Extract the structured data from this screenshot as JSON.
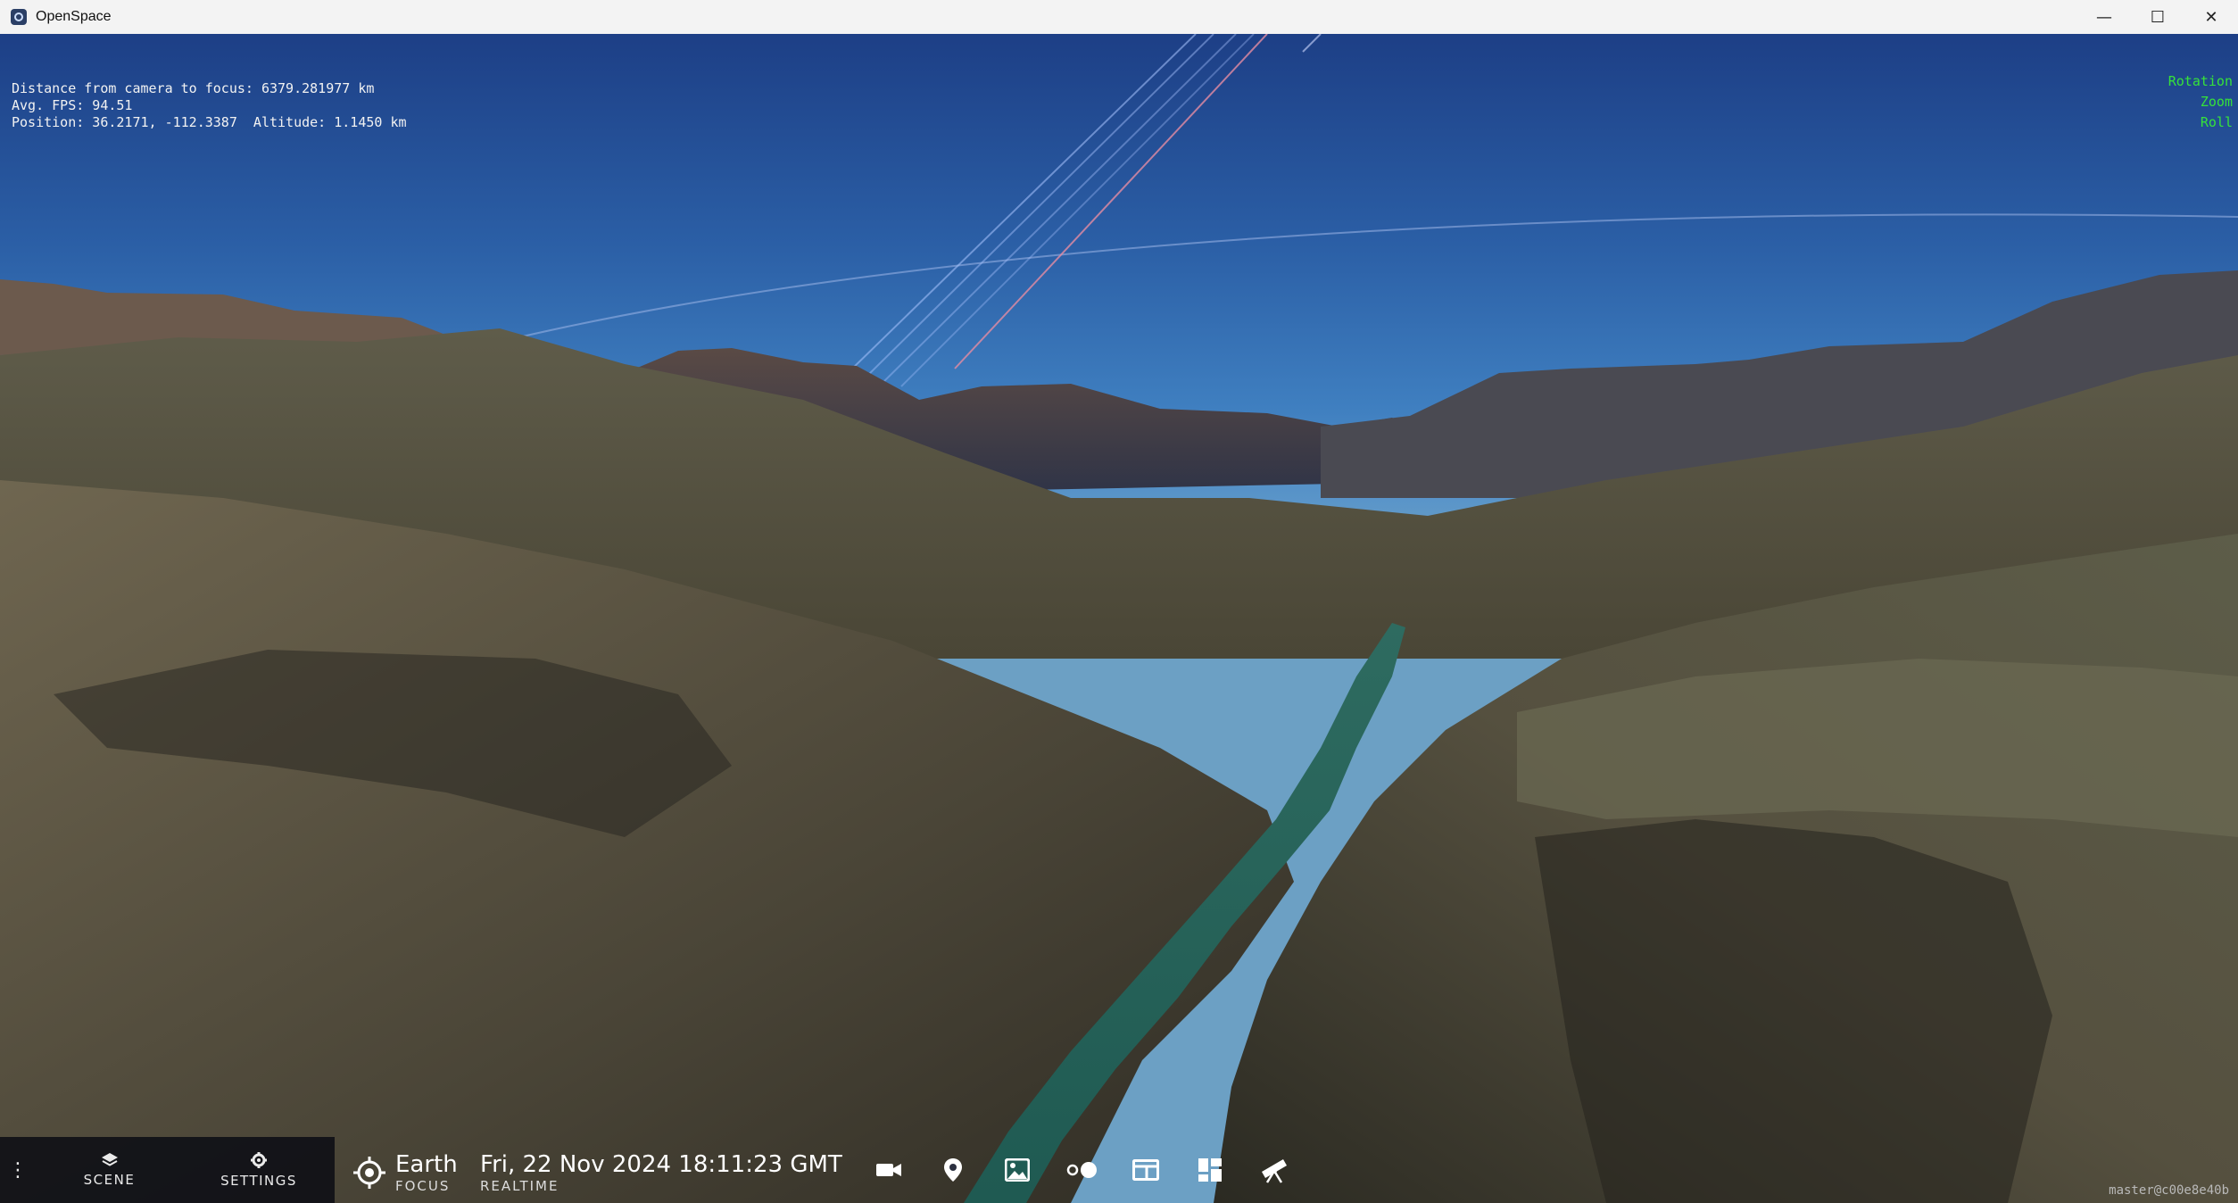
{
  "window": {
    "title": "OpenSpace",
    "minimize": "—",
    "maximize": "☐",
    "close": "✕"
  },
  "overlay": {
    "distance": "Distance from camera to focus: 6379.281977 km",
    "fps": "Avg. FPS: 94.51",
    "position": "Position: 36.2171, -112.3387  Altitude: 1.1450 km"
  },
  "nav_hints": [
    "Rotation",
    "Zoom",
    "Roll"
  ],
  "version": "master@c00e8e40b",
  "bottom_bar": {
    "menu_icon": "⋮",
    "scene_label": "SCENE",
    "settings_label": "SETTINGS",
    "focus": {
      "name": "Earth",
      "sub": "FOCUS"
    },
    "time": {
      "value": "Fri, 22 Nov 2024 18:11:23 GMT",
      "sub": "REALTIME"
    },
    "tools": [
      "camera-icon",
      "map-pin-icon",
      "image-icon",
      "toggle-icon",
      "window-icon",
      "dashboard-icon",
      "telescope-icon"
    ]
  },
  "colors": {
    "overlay_text": "#f2f2f2",
    "nav_hint_text": "#36e23a",
    "panel_bg": "#0c0e14"
  }
}
